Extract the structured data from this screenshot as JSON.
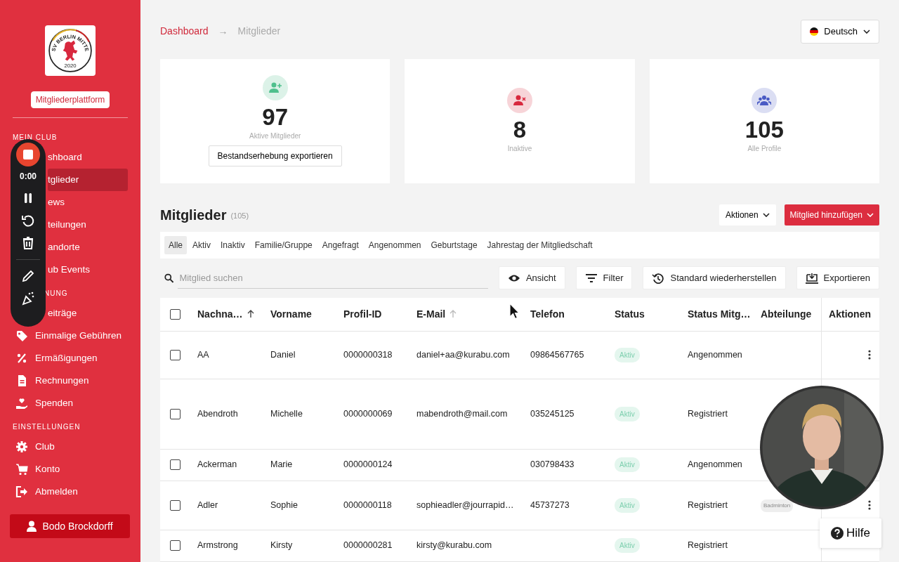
{
  "sidebar": {
    "logo": {
      "arc_text": "SV BERLIN MITTE",
      "year": "2020"
    },
    "platform_label": "Mitgliederplattform",
    "sections": [
      {
        "title": "MEIN CLUB",
        "items": [
          {
            "label": "shboard",
            "selected": false
          },
          {
            "label": "tglieder",
            "selected": true
          },
          {
            "label": "ews",
            "selected": false
          },
          {
            "label": "teilungen",
            "selected": false
          },
          {
            "label": "andorte",
            "selected": false
          },
          {
            "label": "ub Events",
            "selected": false
          }
        ]
      },
      {
        "title": "NUNG",
        "items": [
          {
            "label": "eiträge",
            "selected": false
          },
          {
            "label": "Einmalige Gebühren",
            "selected": false
          },
          {
            "label": "Ermäßigungen",
            "selected": false
          },
          {
            "label": "Rechnungen",
            "selected": false
          },
          {
            "label": "Spenden",
            "selected": false
          }
        ]
      },
      {
        "title": "EINSTELLUNGEN",
        "items": [
          {
            "label": "Club",
            "selected": false
          },
          {
            "label": "Konto",
            "selected": false
          },
          {
            "label": "Abmelden",
            "selected": false
          }
        ]
      }
    ],
    "user_button": "Bodo Brockdorff"
  },
  "recorder": {
    "time": "0:00"
  },
  "breadcrumb": {
    "items": [
      "Dashboard",
      "Mitglieder"
    ],
    "separator": "→"
  },
  "language": "Deutsch",
  "stats": [
    {
      "kind": "active",
      "value": "97",
      "label": "Aktive Mitglieder",
      "color": "#4fc08d",
      "button": "Bestandserhebung exportieren"
    },
    {
      "kind": "inactive",
      "value": "8",
      "label": "Inaktive",
      "color": "#d8283e"
    },
    {
      "kind": "all",
      "value": "105",
      "label": "Alle Profile",
      "color": "#4a5bc4"
    }
  ],
  "members": {
    "title": "Mitglieder",
    "count": "(105)",
    "actions_button": "Aktionen",
    "add_button": "Mitglied hinzufügen",
    "tabs": [
      {
        "label": "Alle",
        "selected": true
      },
      {
        "label": "Aktiv",
        "selected": false
      },
      {
        "label": "Inaktiv",
        "selected": false
      },
      {
        "label": "Familie/Gruppe",
        "selected": false
      },
      {
        "label": "Angefragt",
        "selected": false
      },
      {
        "label": "Angenommen",
        "selected": false
      },
      {
        "label": "Geburtstage",
        "selected": false
      },
      {
        "label": "Jahrestag der Mitgliedschaft",
        "selected": false
      }
    ],
    "search": {
      "placeholder": "Mitglied suchen"
    },
    "tools": [
      {
        "kind": "view",
        "label": "Ansicht"
      },
      {
        "kind": "filter",
        "label": "Filter"
      },
      {
        "kind": "reset",
        "label": "Standard wiederherstellen"
      },
      {
        "kind": "export",
        "label": "Exportieren"
      }
    ],
    "table": {
      "select_all_checked": false,
      "columns": [
        {
          "label": "Nachna…",
          "sortable": true,
          "sorted": true
        },
        {
          "label": "Vorname"
        },
        {
          "label": "Profil-ID"
        },
        {
          "label": "E-Mail",
          "sortable": true,
          "sorted": false
        },
        {
          "label": "Telefon"
        },
        {
          "label": "Status"
        },
        {
          "label": "Status Mitg…"
        },
        {
          "label": "Abteilunge"
        },
        {
          "label": "Aktionen"
        }
      ],
      "rows": [
        {
          "checked": false,
          "last_name": "AA",
          "first_name": "Daniel",
          "profile_id": "0000000318",
          "email": "daniel+aa@kurabu.com",
          "phone": "09864567765",
          "status": "Aktiv",
          "membership": "Angenommen",
          "actions_menu": true
        },
        {
          "checked": false,
          "last_name": "Abendroth",
          "first_name": "Michelle",
          "profile_id": "0000000069",
          "email": "mabendroth@mail.com",
          "phone": "035245125",
          "status": "Aktiv",
          "membership": "Registriert",
          "actions_menu": false
        },
        {
          "checked": false,
          "last_name": "Ackerman",
          "first_name": "Marie",
          "profile_id": "0000000124",
          "phone": "030798433",
          "status": "Aktiv",
          "membership": "Angenommen",
          "actions_menu": false
        },
        {
          "checked": false,
          "last_name": "Adler",
          "first_name": "Sophie",
          "profile_id": "0000000118",
          "email": "sophieadler@jourrapid…",
          "phone": "45737273",
          "status": "Aktiv",
          "membership": "Registriert",
          "department": "Badminton",
          "actions_menu": true
        },
        {
          "checked": false,
          "last_name": "Armstrong",
          "first_name": "Kirsty",
          "profile_id": "0000000281",
          "email": "kirsty@kurabu.com",
          "status": "Aktiv",
          "membership": "Registriert",
          "actions_menu": false
        }
      ]
    }
  },
  "help_button": "Hilfe"
}
